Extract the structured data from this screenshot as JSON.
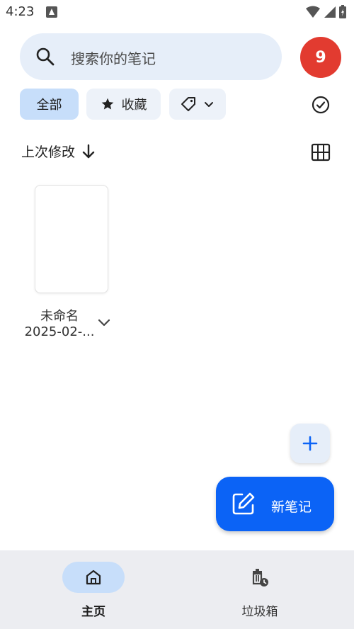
{
  "status_bar": {
    "time": "4:23"
  },
  "search": {
    "placeholder": "搜索你的笔记"
  },
  "avatar": {
    "label": "9",
    "color": "#e23b30"
  },
  "filters": {
    "all_label": "全部",
    "favorites_label": "收藏"
  },
  "sort": {
    "label": "上次修改"
  },
  "notes": [
    {
      "title": "未命名",
      "date": "2025-02-..."
    }
  ],
  "fab": {
    "new_note_label": "新笔记"
  },
  "bottom_nav": {
    "home_label": "主页",
    "trash_label": "垃圾箱"
  },
  "colors": {
    "accent": "#0b63f6",
    "chip_selected": "#c7defa",
    "search_bg": "#e6eef9"
  },
  "icons": [
    "search-icon",
    "star-icon",
    "tag-icon",
    "chevron-down-icon",
    "check-circle-icon",
    "sort-arrow-icon",
    "grid-view-icon",
    "plus-icon",
    "edit-icon",
    "home-icon",
    "trash-icon"
  ]
}
